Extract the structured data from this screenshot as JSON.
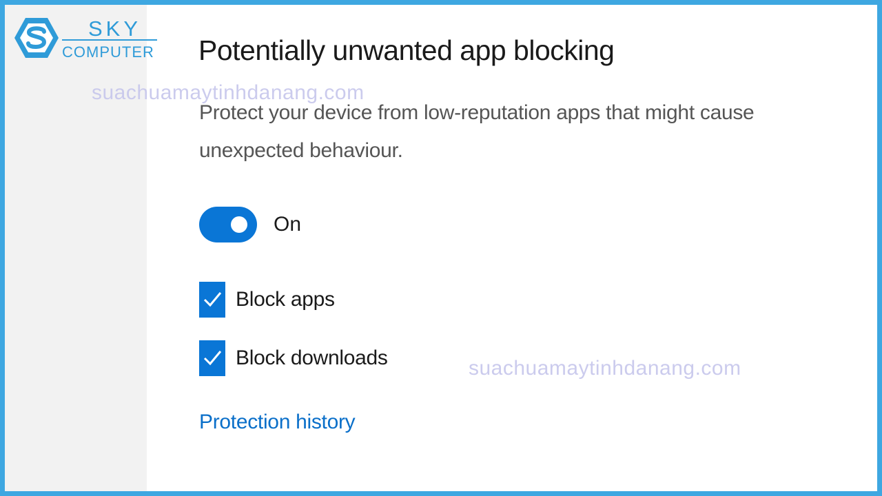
{
  "logo": {
    "line1": "SKY",
    "line2": "COMPUTER",
    "color": "#2f9bd8"
  },
  "section": {
    "title": "Potentially unwanted app blocking",
    "description": "Protect your device from low-reputation apps that might cause unexpected behaviour."
  },
  "toggle": {
    "state_label": "On",
    "is_on": true,
    "color": "#0a76d6"
  },
  "options": [
    {
      "label": "Block apps",
      "checked": true
    },
    {
      "label": "Block downloads",
      "checked": true
    }
  ],
  "link": {
    "label": "Protection history",
    "color": "#0a6fc9"
  },
  "watermarks": [
    "suachuamaytinhdanang.com",
    "suachuamaytinhdanang.com"
  ],
  "colors": {
    "frame": "#3ea7e1",
    "sidebar_bg": "#f2f2f2",
    "accent": "#0a76d6"
  }
}
